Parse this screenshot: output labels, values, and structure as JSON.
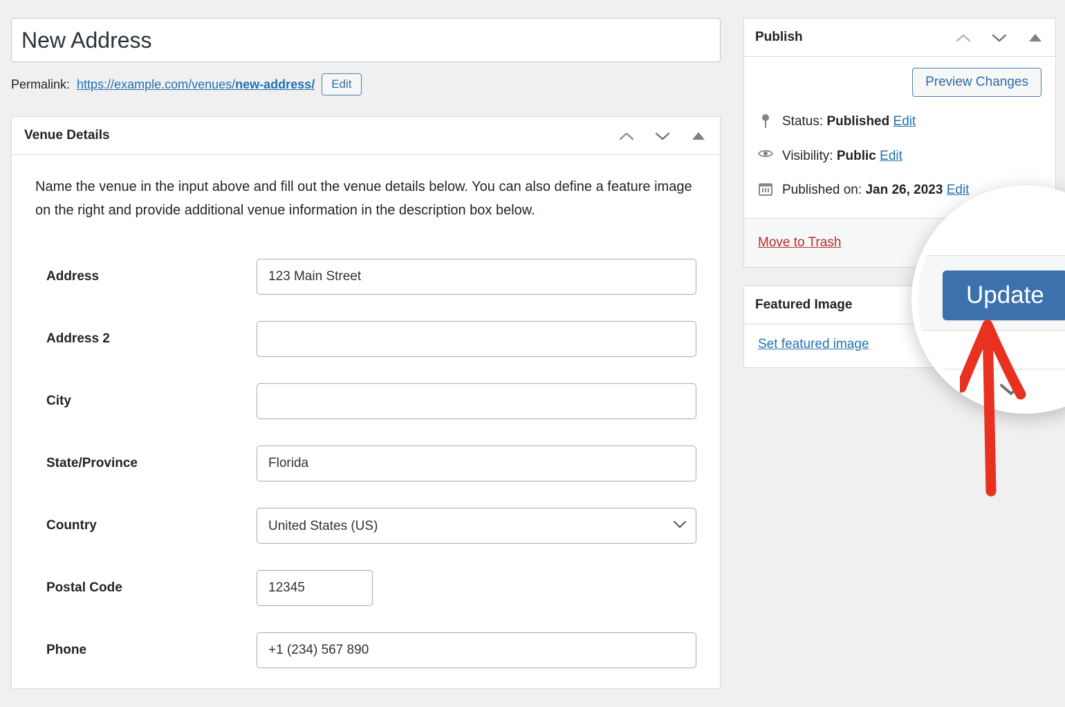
{
  "editor": {
    "title_value": "New Address",
    "title_placeholder": "Add title",
    "permalink_label": "Permalink:",
    "permalink_url_prefix": "https://example.com/venues/",
    "permalink_slug": "new-address/",
    "edit_permalink_label": "Edit"
  },
  "venue_panel": {
    "title": "Venue Details",
    "intro": "Name the venue in the input above and fill out the venue details below. You can also define a feature image on the right and provide additional venue information in the description box below.",
    "fields": [
      {
        "label": "Address",
        "type": "text",
        "value": "123 Main Street",
        "placeholder": "",
        "width": "full"
      },
      {
        "label": "Address 2",
        "type": "text",
        "value": "",
        "placeholder": "",
        "width": "full"
      },
      {
        "label": "City",
        "type": "text",
        "value": "",
        "placeholder": "",
        "width": "full"
      },
      {
        "label": "State/Province",
        "type": "text",
        "value": "Florida",
        "placeholder": "",
        "width": "full"
      },
      {
        "label": "Country",
        "type": "select",
        "value": "United States (US)",
        "placeholder": "",
        "width": "full"
      },
      {
        "label": "Postal Code",
        "type": "text",
        "value": "12345",
        "placeholder": "",
        "width": "short"
      },
      {
        "label": "Phone",
        "type": "text",
        "value": "+1 (234) 567 890",
        "placeholder": "",
        "width": "full"
      }
    ]
  },
  "publish_panel": {
    "title": "Publish",
    "preview_label": "Preview Changes",
    "status_prefix": "Status:",
    "status_value": "Published",
    "status_edit": "Edit",
    "visibility_prefix": "Visibility:",
    "visibility_value": "Public",
    "visibility_edit": "Edit",
    "published_prefix": "Published on:",
    "published_value": "Jan 26, 2023",
    "published_edit": "Edit",
    "trash_label": "Move to Trash",
    "update_label": "Update"
  },
  "featured_panel": {
    "title": "Featured Image",
    "set_link": "Set featured image"
  },
  "callout": {
    "magnified_button_label": "Update",
    "arrow_color": "#e8311f",
    "arrow_points_to": "update-button"
  },
  "colors": {
    "page_background": "#f0f0f1",
    "panel_background": "#ffffff",
    "panel_border": "#d5d8dc",
    "link_blue": "#2271b1",
    "primary_button": "#3c71ad",
    "trash_red": "#b32d2e",
    "annotation_red": "#e8311f",
    "text": "#1d2327"
  },
  "icons": {
    "status": "pin-icon",
    "visibility": "eye-icon",
    "published": "calendar-icon",
    "move_up": "chevron-up-icon",
    "move_down": "chevron-down-icon",
    "toggle": "triangle-up-icon",
    "select": "chevron-down-icon"
  }
}
